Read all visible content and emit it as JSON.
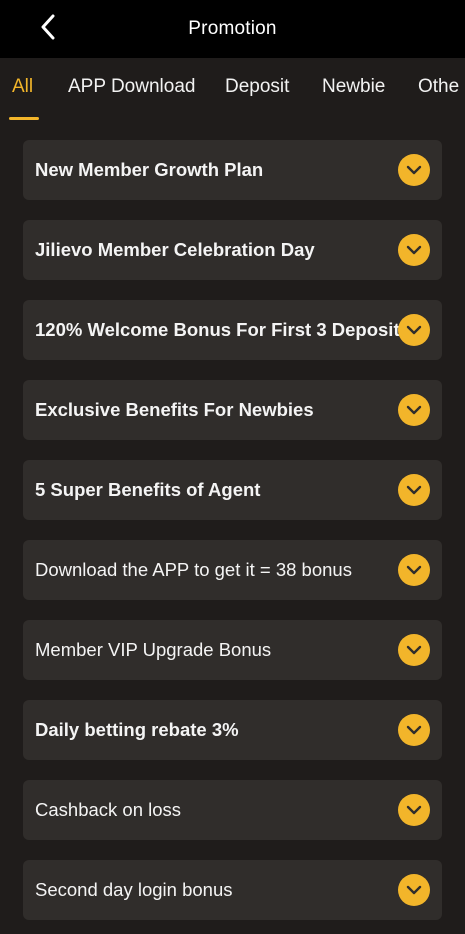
{
  "header": {
    "title": "Promotion",
    "back_icon": "chevron-left-icon"
  },
  "tabs": [
    {
      "label": "All",
      "active": true
    },
    {
      "label": "APP Download",
      "active": false
    },
    {
      "label": "Deposit",
      "active": false
    },
    {
      "label": "Newbie",
      "active": false
    },
    {
      "label": "Othe",
      "active": false
    }
  ],
  "promotions": [
    {
      "label": "New Member Growth Plan",
      "bold": true
    },
    {
      "label": "Jilievo Member Celebration Day",
      "bold": true
    },
    {
      "label": "120% Welcome Bonus For First 3 Deposit",
      "bold": true
    },
    {
      "label": "Exclusive Benefits For Newbies",
      "bold": true
    },
    {
      "label": "5 Super Benefits of Agent",
      "bold": true
    },
    {
      "label": "Download the APP to get it = 38 bonus",
      "bold": false
    },
    {
      "label": "Member VIP Upgrade Bonus",
      "bold": false
    },
    {
      "label": "Daily betting rebate 3%",
      "bold": true
    },
    {
      "label": "Cashback on loss",
      "bold": false
    },
    {
      "label": "Second day login bonus",
      "bold": false
    }
  ],
  "colors": {
    "accent": "#f2b52a",
    "background": "#1f1c1b",
    "card": "#302d2b",
    "header": "#000000"
  }
}
